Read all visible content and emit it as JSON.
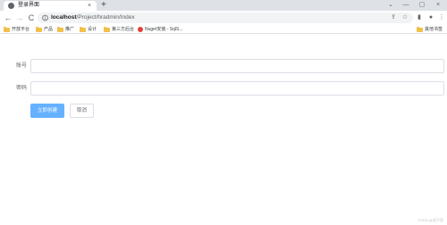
{
  "browser": {
    "tab": {
      "title": "登录界面",
      "close": "×"
    },
    "new_tab": "+",
    "window_controls": [
      "⌄",
      "—",
      "▢",
      "×"
    ],
    "nav": {
      "back": "←",
      "forward": "→",
      "reload": "C"
    },
    "address": {
      "host": "localhost",
      "path": "/Project/hradmin/Index"
    },
    "omnibox_icons": {
      "share": "⇪",
      "star": "☆"
    },
    "toolbar_icons": {
      "sidebar": "▮",
      "profile": "●",
      "menu": "⋮"
    }
  },
  "bookmarks": {
    "items": [
      {
        "label": "开放平台",
        "type": "folder"
      },
      {
        "label": "产品",
        "type": "folder"
      },
      {
        "label": "推广",
        "type": "folder"
      },
      {
        "label": "设计",
        "type": "folder"
      },
      {
        "label": "第三方后台",
        "type": "folder"
      },
      {
        "label": "Nuget安装 - SqlS...",
        "type": "site"
      }
    ],
    "other": "其他书签"
  },
  "form": {
    "account_label": "账号",
    "account_value": "",
    "password_label": "密码",
    "password_value": "",
    "submit_label": "立即创建",
    "cancel_label": "取消"
  },
  "watermark": "CSDN @君子君"
}
